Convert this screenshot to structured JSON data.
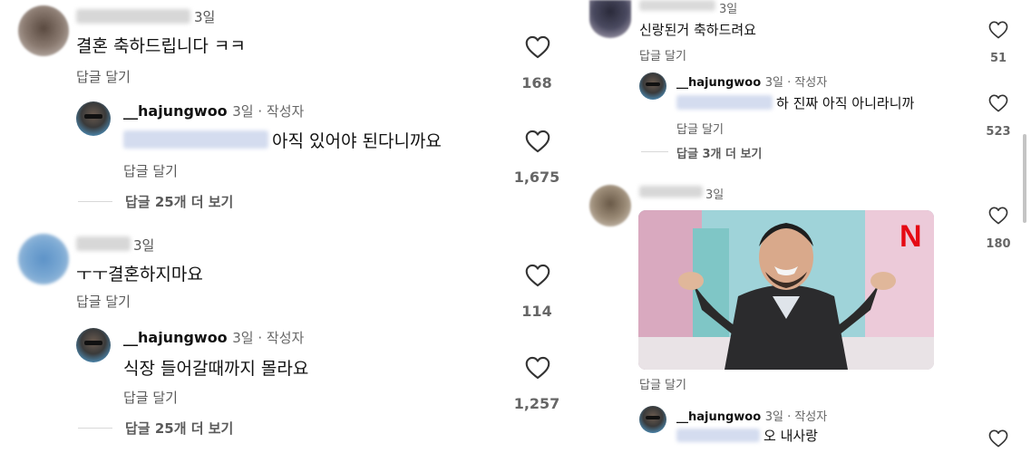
{
  "left_column": {
    "c1": {
      "time": "3일",
      "text": "결혼 축하드립니다 ㅋㅋ",
      "reply_label": "답글 달기",
      "likes": "168",
      "author_reply": {
        "username": "__hajungwoo",
        "time_author": "3일 · 작성자",
        "text": "아직 있어야 된다니까요",
        "reply_label": "답글 달기",
        "likes": "1,675"
      },
      "view_more": "답글 25개 더 보기"
    },
    "c2": {
      "time": "3일",
      "text": "ㅜㅜ결혼하지마요",
      "reply_label": "답글 달기",
      "likes": "114",
      "author_reply": {
        "username": "__hajungwoo",
        "time_author": "3일 · 작성자",
        "text": "식장 들어갈때까지 몰라요",
        "reply_label": "답글 달기",
        "likes": "1,257"
      },
      "view_more": "답글 25개 더 보기"
    }
  },
  "right_column": {
    "c3": {
      "time": "3일",
      "text": "신랑된거 축하드려요",
      "reply_label": "답글 달기",
      "likes": "51",
      "author_reply": {
        "username": "__hajungwoo",
        "time_author": "3일 · 작성자",
        "text": "하 진짜 아직 아니라니까",
        "reply_label": "답글 달기",
        "likes": "523"
      },
      "view_more": "답글 3개 더 보기"
    },
    "c4": {
      "time": "3일",
      "reply_label": "답글 달기",
      "likes": "180",
      "image_logo": "N",
      "author_reply": {
        "username": "__hajungwoo",
        "time_author": "3일 · 작성자",
        "text": "오 내사랑"
      }
    }
  },
  "icons": {
    "like": "heart-outline-icon"
  },
  "colors": {
    "mention": "#d4dcef",
    "logo": "#e50914"
  }
}
